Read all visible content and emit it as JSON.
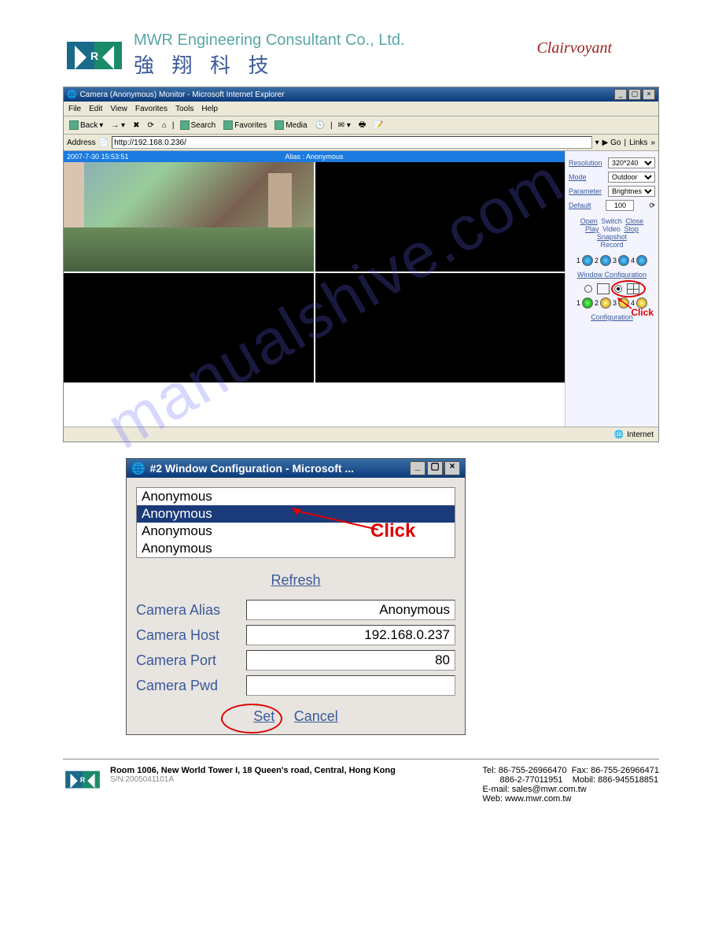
{
  "header": {
    "company_en": "MWR Engineering Consultant Co., Ltd.",
    "company_zh": "強 翔 科 技",
    "clairvoyant": "Clairvoyant"
  },
  "browser": {
    "title": "Camera (Anonymous) Monitor - Microsoft Internet Explorer",
    "menus": {
      "file": "File",
      "edit": "Edit",
      "view": "View",
      "favorites": "Favorites",
      "tools": "Tools",
      "help": "Help"
    },
    "toolbar": {
      "back": "Back",
      "search": "Search",
      "favorites": "Favorites",
      "media": "Media"
    },
    "address_label": "Address",
    "address_url": "http://192.168.0.236/",
    "go": "Go",
    "links": "Links",
    "status_zone": "Internet"
  },
  "camera": {
    "timestamp": "2007-7-30 15:53:51",
    "alias_header": "Alias : Anonymous",
    "panel": {
      "resolution_label": "Resolution",
      "resolution_value": "320*240",
      "mode_label": "Mode",
      "mode_value": "Outdoor",
      "parameter_label": "Parameter",
      "parameter_value": "Brightness",
      "default_label": "Default",
      "default_value": "100",
      "open": "Open",
      "switch": "Switch",
      "close": "Close",
      "play": "Play",
      "video": "Video",
      "stop": "Stop",
      "snapshot": "Snapshot",
      "record": "Record",
      "window_config": "Window Configuration",
      "configuration": "Configuration",
      "click_annotation": "Click"
    }
  },
  "dialog": {
    "title": "#2 Window Configuration - Microsoft ...",
    "list_items": [
      "Anonymous",
      "Anonymous",
      "Anonymous",
      "Anonymous"
    ],
    "selected_index": 1,
    "refresh": "Refresh",
    "fields": {
      "camera_alias_label": "Camera Alias",
      "camera_alias_value": "Anonymous",
      "camera_host_label": "Camera Host",
      "camera_host_value": "192.168.0.237",
      "camera_port_label": "Camera Port",
      "camera_port_value": "80",
      "camera_pwd_label": "Camera Pwd",
      "camera_pwd_value": ""
    },
    "set": "Set",
    "cancel": "Cancel",
    "click_annotation": "Click"
  },
  "footer": {
    "address": "Room 1006, New World Tower I, 18 Queen's road, Central, Hong Kong",
    "sn": "S/N:2005041101A",
    "tel": "Tel: 86-755-26966470",
    "fax": "Fax: 86-755-26966471",
    "tel2": "886-2-77011951",
    "mobil": "Mobil: 886-945518851",
    "email": "E-mail: sales@mwr.com.tw",
    "web": "Web: www.mwr.com.tw"
  },
  "watermark": "manualshive.com"
}
